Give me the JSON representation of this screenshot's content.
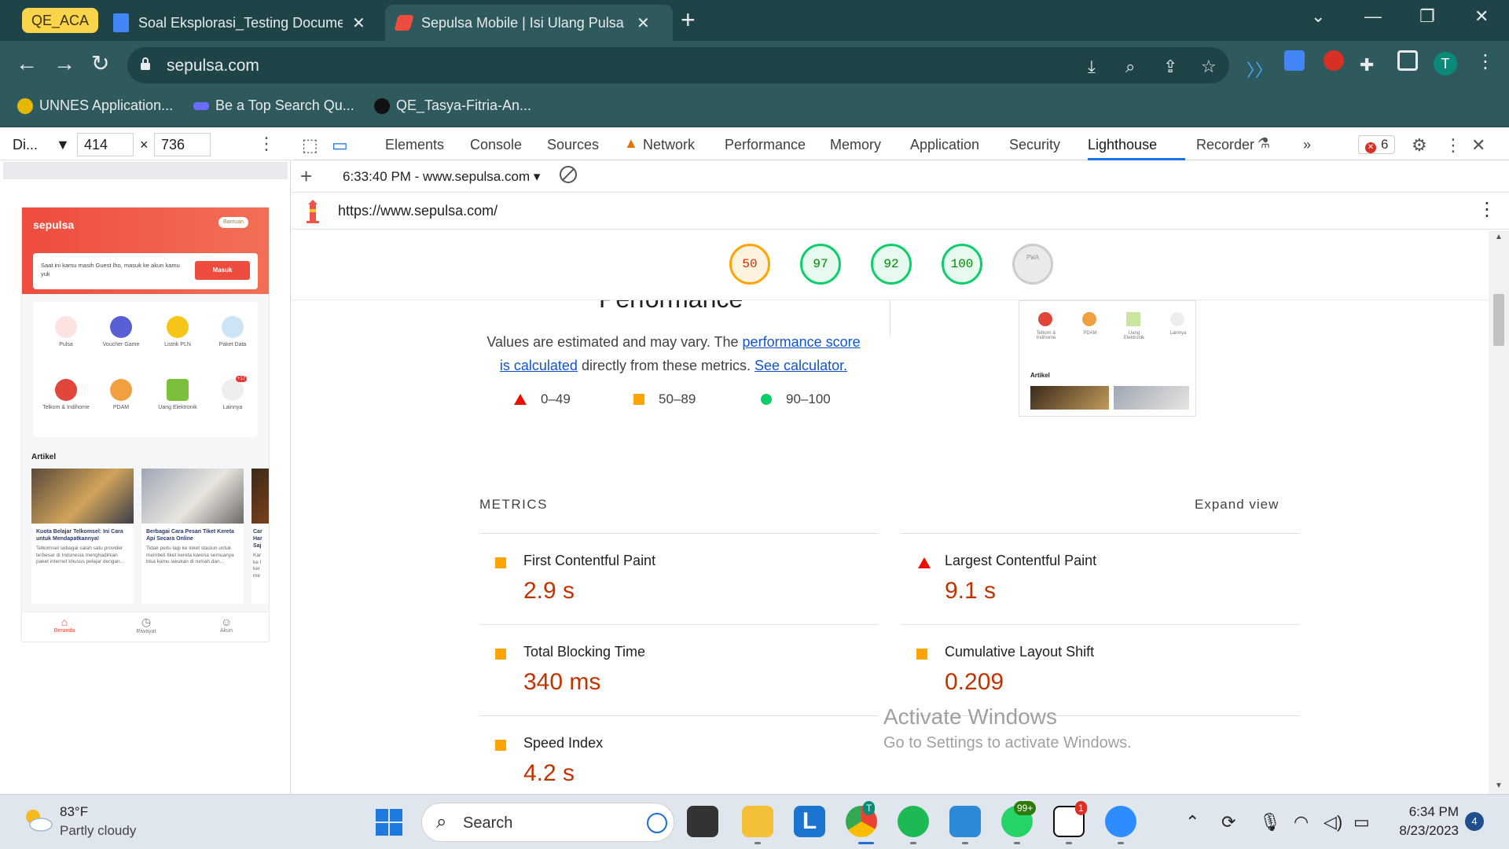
{
  "browser": {
    "profile_label": "QE_ACA",
    "tabs": [
      {
        "title": "Soal Eksplorasi_Testing Documen",
        "close": "✕"
      },
      {
        "title": "Sepulsa Mobile | Isi Ulang Pulsa S",
        "close": "✕"
      }
    ],
    "new_tab": "+",
    "window_controls": [
      "⌄",
      "—",
      "❐",
      "✕"
    ],
    "url": "sepulsa.com",
    "nav": {
      "back": "←",
      "forward": "→",
      "reload": "↻"
    },
    "profile_initial": "T",
    "bookmarks": [
      {
        "label": "UNNES Application..."
      },
      {
        "label": "Be a Top Search Qu..."
      },
      {
        "label": "QE_Tasya-Fitria-An..."
      }
    ]
  },
  "device_toolbar": {
    "device": "Di...",
    "width": "414",
    "height": "736",
    "times": "×"
  },
  "phone": {
    "logo": "sepulsa",
    "help": "Bantuan",
    "guest_text": "Saat ini kamu masih Guest lho, masuk ke akun kamu yuk",
    "login_button": "Masuk",
    "menu": [
      {
        "label": "Pulsa",
        "color": "#ee4c3e"
      },
      {
        "label": "Voucher Game",
        "color": "#5b5fd6"
      },
      {
        "label": "Listrik PLN",
        "color": "#f5c518"
      },
      {
        "label": "Paket Data",
        "color": "#6aa8e8"
      },
      {
        "label": "Telkom & Indihome",
        "color": "#e2463b"
      },
      {
        "label": "PDAM",
        "color": "#f0a040"
      },
      {
        "label": "Uang Elektronik",
        "color": "#7bbf3d"
      },
      {
        "label": "Lainnya",
        "color": "#cccccc"
      }
    ],
    "lainnya_badge": "+17",
    "artikel_title": "Artikel",
    "articles": [
      {
        "title": "Kuota Belajar Telkomsel: Ini Cara untuk Mendapatkannya!",
        "body": "Telkomsel sebagai salah satu provider terbesar di Indonesia menghadirkan paket internet khusus pelajar dengan..."
      },
      {
        "title": "Berbagai Cara Pesan Tiket Kereta Api Secara Online",
        "body": "Tidak perlu lagi ke loket stasiun untuk membeli tiket kereta karena semuanya bisa kamu lakukan di rumah dan..."
      },
      {
        "title": "Car Har Saj",
        "body": "Kar ke l ker me"
      }
    ],
    "bottom_nav": [
      {
        "label": "Beranda",
        "icon": "home-icon"
      },
      {
        "label": "Riwayat",
        "icon": "clock-icon"
      },
      {
        "label": "Akun",
        "icon": "user-icon"
      }
    ]
  },
  "devtools": {
    "tabs": [
      "Elements",
      "Console",
      "Sources",
      "Network",
      "Performance",
      "Memory",
      "Application",
      "Security",
      "Lighthouse",
      "Recorder"
    ],
    "active_tab": "Lighthouse",
    "more_tabs": "»",
    "error_count": "6",
    "lighthouse": {
      "report_label": "6:33:40 PM - www.sepulsa.com",
      "url": "https://www.sepulsa.com/",
      "scores": [
        {
          "value": "50",
          "status": "average"
        },
        {
          "value": "97",
          "status": "pass"
        },
        {
          "value": "92",
          "status": "pass"
        },
        {
          "value": "100",
          "status": "pass"
        }
      ],
      "pwa_label": "PWA",
      "section_title": "Performance",
      "note_prefix": "Values are estimated and may vary. The ",
      "note_link1": "performance score is calculated",
      "note_middle": " directly from these metrics. ",
      "note_link2": "See calculator.",
      "legend": [
        {
          "range": "0–49",
          "shape": "triangle",
          "color": "#eb0f00"
        },
        {
          "range": "50–89",
          "shape": "square",
          "color": "#ffa400"
        },
        {
          "range": "90–100",
          "shape": "circle",
          "color": "#0cce6b"
        }
      ],
      "thumb": {
        "labels": [
          "Telkom & Indihome",
          "PDAM",
          "Uang Elektronik",
          "Lainnya"
        ],
        "artikel": "Artikel"
      },
      "metrics_label": "METRICS",
      "expand_view": "Expand view",
      "metrics": [
        {
          "name": "First Contentful Paint",
          "value": "2.9 s",
          "rating": "average"
        },
        {
          "name": "Largest Contentful Paint",
          "value": "9.1 s",
          "rating": "fail"
        },
        {
          "name": "Total Blocking Time",
          "value": "340 ms",
          "rating": "average"
        },
        {
          "name": "Cumulative Layout Shift",
          "value": "0.209",
          "rating": "average"
        },
        {
          "name": "Speed Index",
          "value": "4.2 s",
          "rating": "average"
        }
      ]
    }
  },
  "watermark": {
    "title": "Activate Windows",
    "subtitle": "Go to Settings to activate Windows."
  },
  "taskbar": {
    "temperature": "83°F",
    "weather": "Partly cloudy",
    "search_label": "Search",
    "whatsapp_badge": "99+",
    "notion_badge": "1",
    "chrome_badge": "T",
    "time": "6:34 PM",
    "date": "8/23/2023",
    "notification_count": "4"
  }
}
